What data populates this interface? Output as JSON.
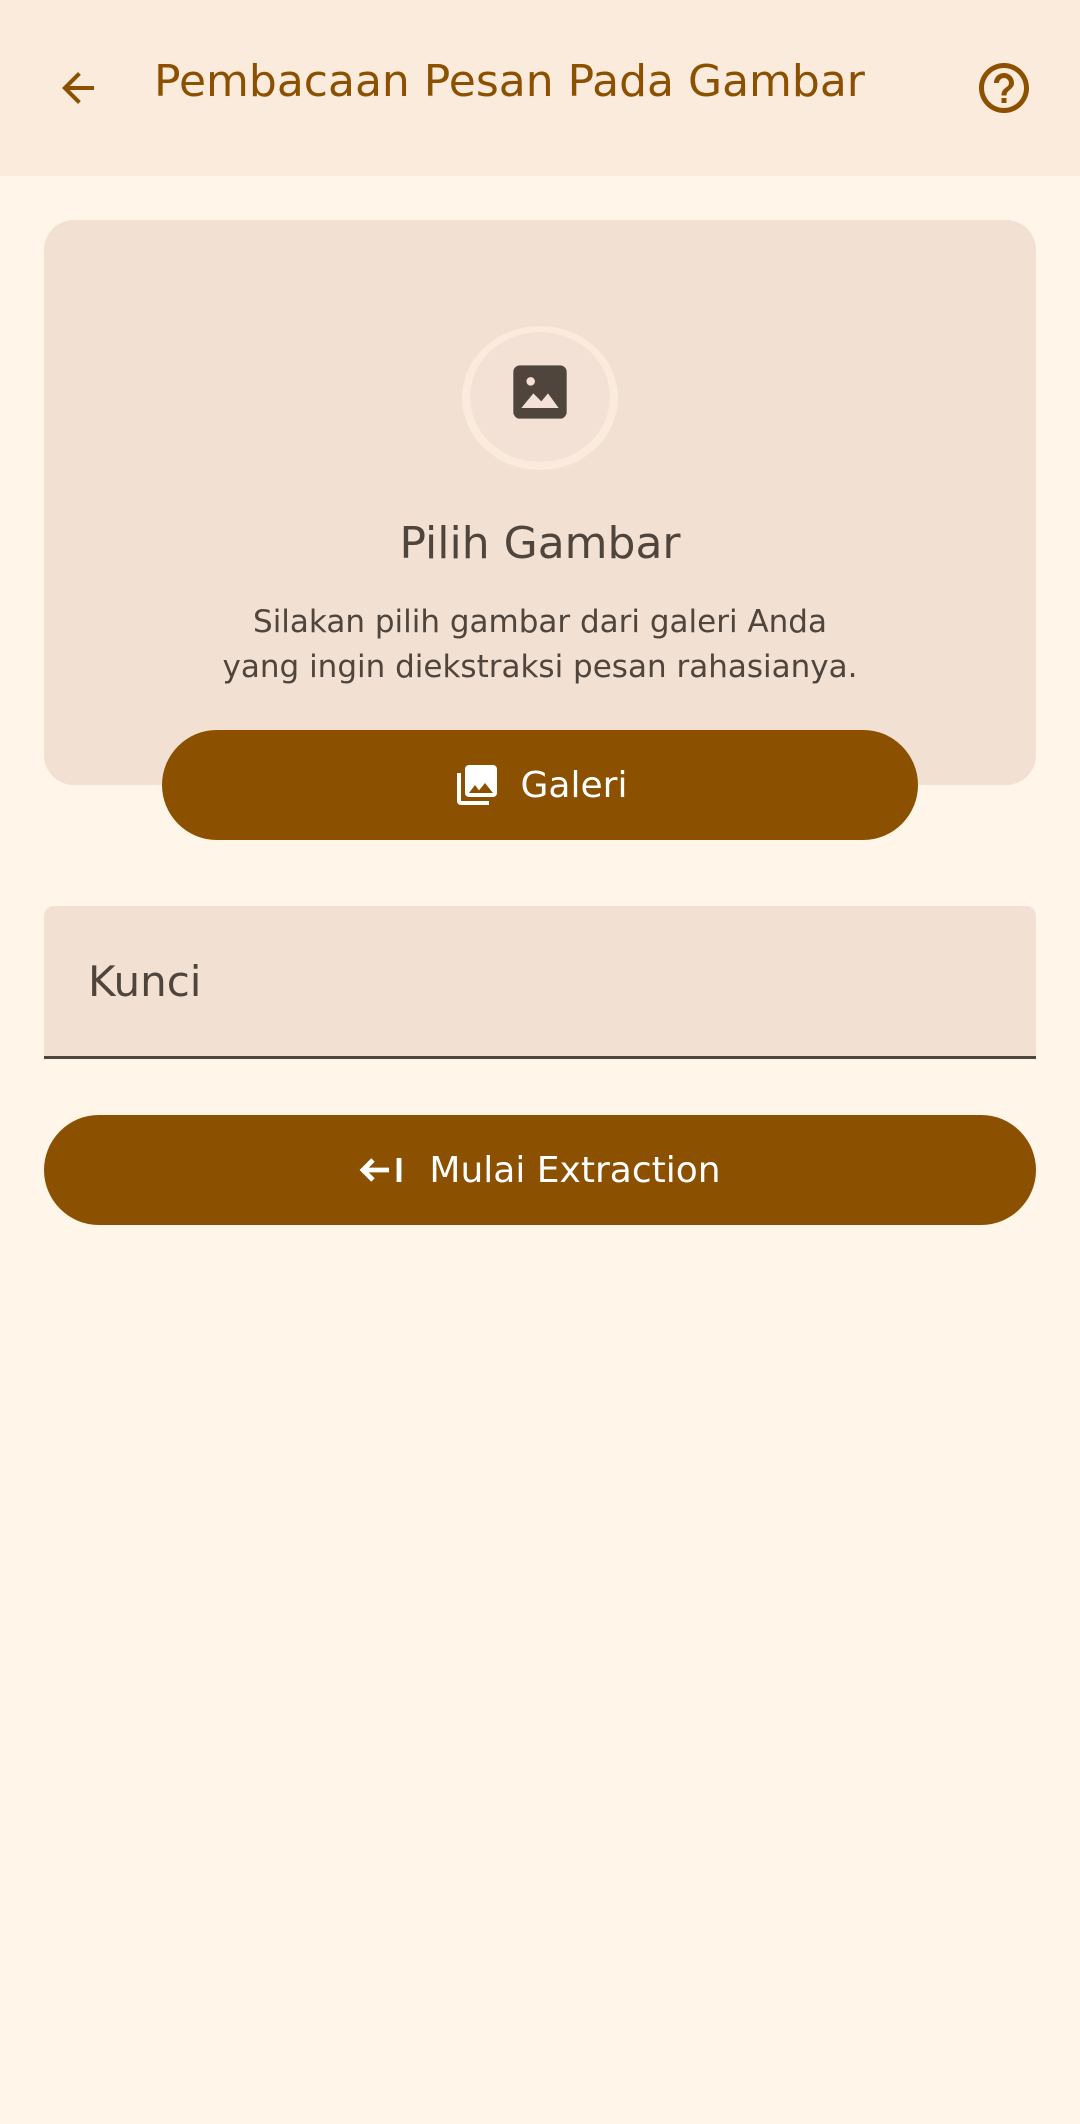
{
  "app_bar": {
    "title": "Pembacaan Pesan Pada Gambar",
    "back_icon": "arrow-back-icon",
    "help_icon": "help-circle-icon"
  },
  "picker_card": {
    "icon": "image-icon",
    "title": "Pilih Gambar",
    "description_line1": "Silakan pilih gambar dari galeri Anda",
    "description_line2": "yang ingin diekstraksi pesan rahasianya.",
    "gallery_button": {
      "icon": "photo-library-icon",
      "label": "Galeri"
    }
  },
  "key_field": {
    "placeholder": "Kunci",
    "value": ""
  },
  "extract_button": {
    "icon": "arrow-left-to-line-icon",
    "label": "Mulai Extraction"
  },
  "colors": {
    "primary": "#8B5000",
    "background": "#FFF5E8",
    "app_bar": "#FBEBDD",
    "surface": "#F2E0D3",
    "on_surface": "#4F453D"
  }
}
